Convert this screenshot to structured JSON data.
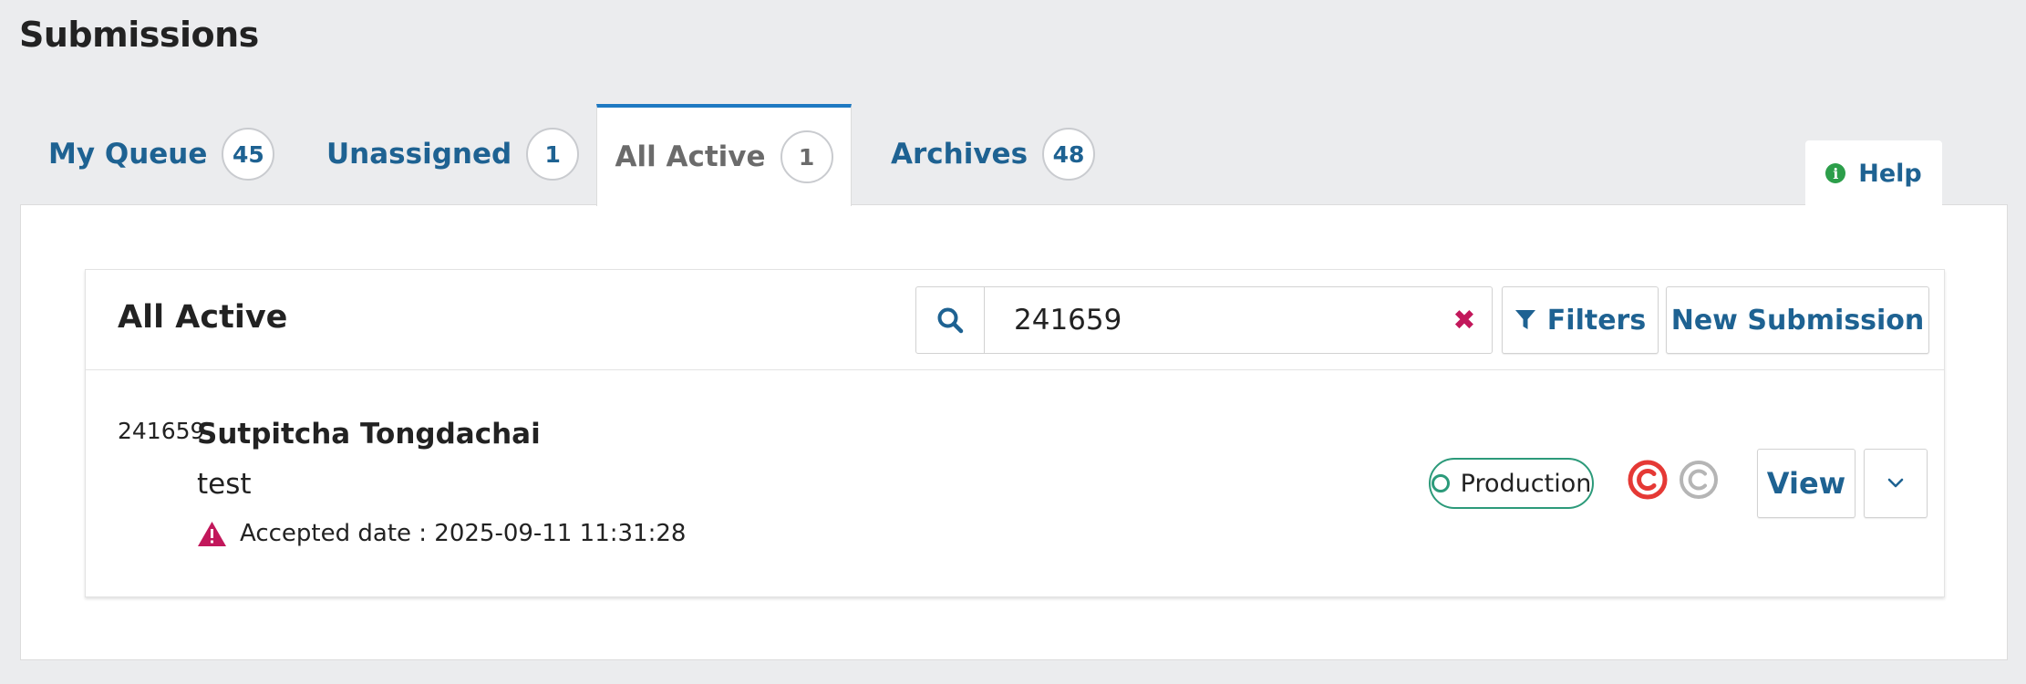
{
  "page": {
    "title": "Submissions"
  },
  "tabs": [
    {
      "label": "My Queue",
      "count": "45"
    },
    {
      "label": "Unassigned",
      "count": "1"
    },
    {
      "label": "All Active",
      "count": "1"
    },
    {
      "label": "Archives",
      "count": "48"
    }
  ],
  "active_tab": "All Active",
  "help": {
    "label": "Help"
  },
  "list": {
    "title": "All Active",
    "search": {
      "value": "241659"
    },
    "filters_label": "Filters",
    "new_submission_label": "New Submission"
  },
  "submissions": [
    {
      "id": "241659",
      "author": "Sutpitcha Tongdachai",
      "title": "test",
      "notice": "Accepted date : 2025-09-11 11:31:28",
      "stage": "Production",
      "view_label": "View"
    }
  ],
  "colors": {
    "link": "#1e6292",
    "active_tab_border": "#1e79c2",
    "stage_green": "#2c9a7a",
    "warning": "#c2185b",
    "copyright_red": "#e53935",
    "copyright_gray": "#b5b5b5"
  },
  "icons": {
    "search": "search-icon",
    "clear": "clear-icon",
    "filter": "filter-icon",
    "warning": "warning-icon",
    "copyright_active": "copyright-icon",
    "copyright_inactive": "copyright-icon",
    "more": "chevron-down-icon",
    "help": "info-icon"
  }
}
